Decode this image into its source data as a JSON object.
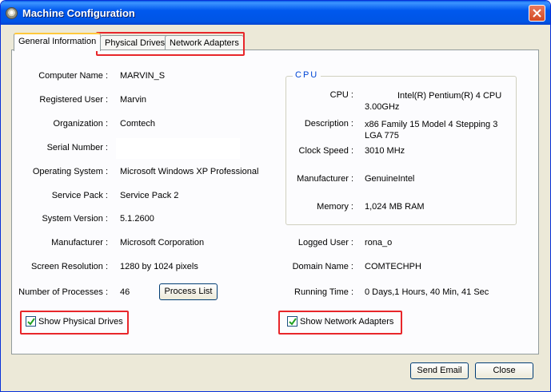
{
  "window": {
    "title": "Machine Configuration",
    "close_glyph": "✕"
  },
  "tabs": [
    {
      "label": "General Information",
      "active": true
    },
    {
      "label": "Physical Drives",
      "active": false
    },
    {
      "label": "Network Adapters",
      "active": false
    }
  ],
  "general": {
    "computer_name": {
      "label": "Computer Name :",
      "value": "MARVIN_S"
    },
    "registered_user": {
      "label": "Registered User :",
      "value": "Marvin"
    },
    "organization": {
      "label": "Organization :",
      "value": "Comtech"
    },
    "serial_number": {
      "label": "Serial Number :",
      "value": ""
    },
    "operating_system": {
      "label": "Operating System :",
      "value": "Microsoft Windows XP Professional"
    },
    "service_pack": {
      "label": "Service Pack :",
      "value": "Service Pack 2"
    },
    "system_version": {
      "label": "System Version :",
      "value": "5.1.2600"
    },
    "manufacturer": {
      "label": "Manufacturer :",
      "value": "Microsoft Corporation"
    },
    "screen_resolution": {
      "label": "Screen Resolution :",
      "value": "1280 by 1024 pixels"
    },
    "processes": {
      "label": "Number of Processes :",
      "value": "46"
    },
    "process_list_button": "Process List"
  },
  "cpu": {
    "legend": "CPU",
    "cpu": {
      "label": "CPU :",
      "value": "Intel(R) Pentium(R) 4 CPU 3.00GHz"
    },
    "description": {
      "label": "Description :",
      "value": "x86 Family 15 Model 4 Stepping 3 LGA 775"
    },
    "clock_speed": {
      "label": "Clock Speed :",
      "value": "3010 MHz"
    },
    "manufacturer": {
      "label": "Manufacturer :",
      "value": "GenuineIntel"
    },
    "memory": {
      "label": "Memory :",
      "value": "1,024 MB RAM"
    }
  },
  "session": {
    "logged_user": {
      "label": "Logged User :",
      "value": "rona_o"
    },
    "domain_name": {
      "label": "Domain Name :",
      "value": "COMTECHPH"
    },
    "running_time": {
      "label": "Running Time :",
      "value": "0 Days,1 Hours, 40 Min, 41 Sec"
    }
  },
  "checkboxes": {
    "show_physical_drives": {
      "label": "Show Physical Drives",
      "checked": true
    },
    "show_network_adapters": {
      "label": "Show Network Adapters",
      "checked": true
    }
  },
  "buttons": {
    "send_email": "Send Email",
    "close": "Close"
  },
  "colors": {
    "titlebar": "#0055e5",
    "highlight": "#e8262a",
    "cpu_legend": "#0046d5",
    "checkmark": "#21a121"
  },
  "icons": {
    "app": "app-icon",
    "close": "close-icon",
    "check": "checkmark-icon"
  }
}
